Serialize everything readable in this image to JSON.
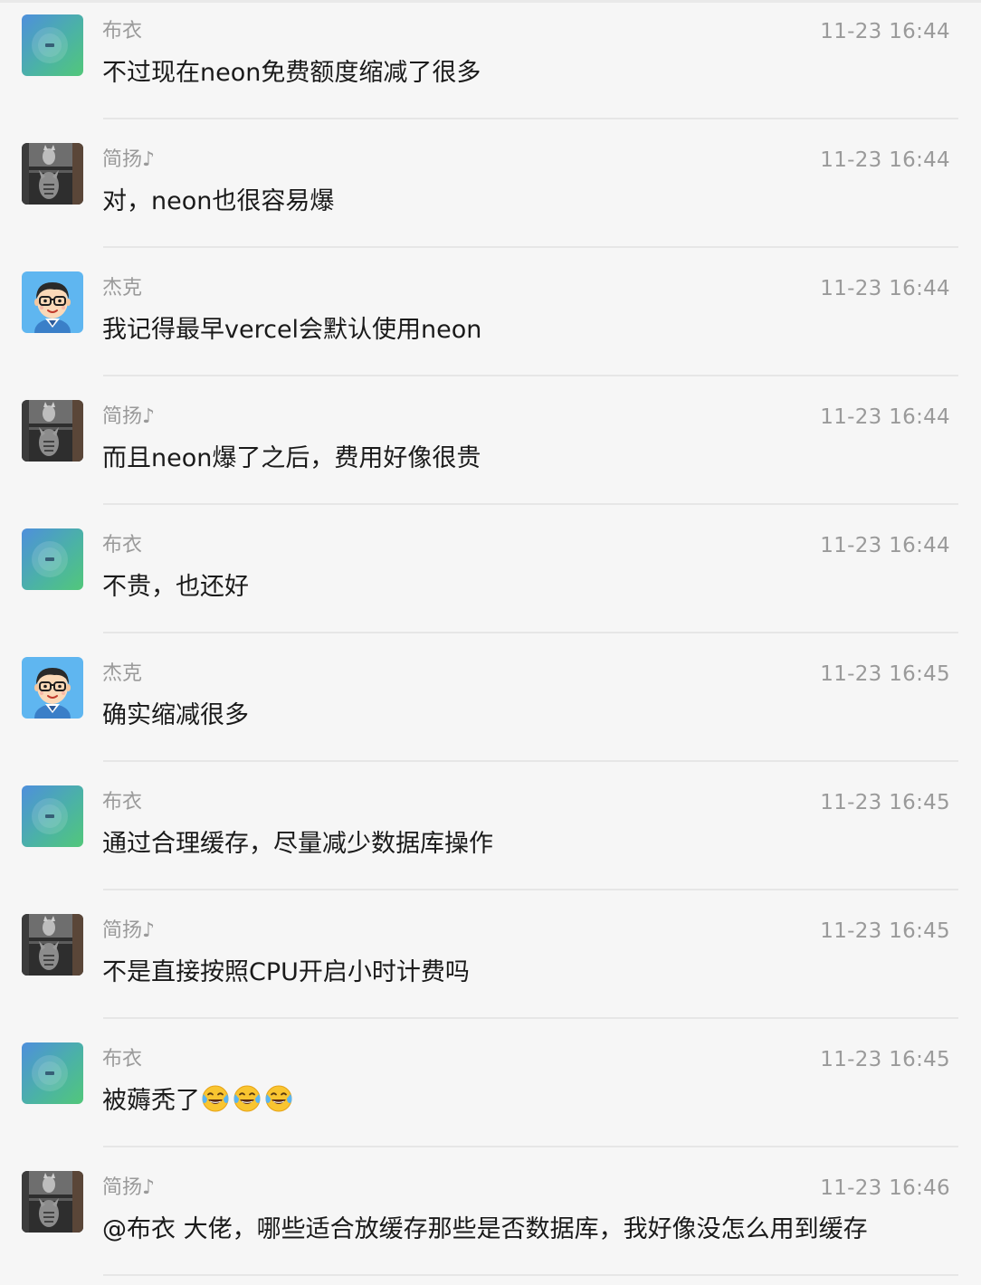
{
  "messages": [
    {
      "sender": "布衣",
      "avatar": "gradient-avatar-icon",
      "time": "11-23 16:44",
      "text": "不过现在neon免费额度缩减了很多"
    },
    {
      "sender": "简扬♪",
      "avatar": "cat-tiger-reflection-photo",
      "time": "11-23 16:44",
      "text": "对，neon也很容易爆"
    },
    {
      "sender": "杰克",
      "avatar": "cartoon-boy-glasses-avatar",
      "time": "11-23 16:44",
      "text": "我记得最早vercel会默认使用neon"
    },
    {
      "sender": "简扬♪",
      "avatar": "cat-tiger-reflection-photo",
      "time": "11-23 16:44",
      "text": "而且neon爆了之后，费用好像很贵"
    },
    {
      "sender": "布衣",
      "avatar": "gradient-avatar-icon",
      "time": "11-23 16:44",
      "text": "不贵，也还好"
    },
    {
      "sender": "杰克",
      "avatar": "cartoon-boy-glasses-avatar",
      "time": "11-23 16:45",
      "text": "确实缩减很多"
    },
    {
      "sender": "布衣",
      "avatar": "gradient-avatar-icon",
      "time": "11-23 16:45",
      "text": "通过合理缓存，尽量减少数据库操作"
    },
    {
      "sender": "简扬♪",
      "avatar": "cat-tiger-reflection-photo",
      "time": "11-23 16:45",
      "text": "不是直接按照CPU开启小时计费吗"
    },
    {
      "sender": "布衣",
      "avatar": "gradient-avatar-icon",
      "time": "11-23 16:45",
      "text": "被薅秃了",
      "emoji": [
        "tears-of-joy-emoji",
        "tears-of-joy-emoji",
        "tears-of-joy-emoji"
      ]
    },
    {
      "sender": "简扬♪",
      "avatar": "cat-tiger-reflection-photo",
      "time": "11-23 16:46",
      "text": "@布衣 大佬，哪些适合放缓存那些是否数据库，我好像没怎么用到缓存"
    }
  ],
  "colors": {
    "background": "#f6f6f6",
    "sender_text": "#9a9a9a",
    "time_text": "#9a9a9a",
    "message_text": "#1a1a1a",
    "divider": "#e6e6e6"
  }
}
